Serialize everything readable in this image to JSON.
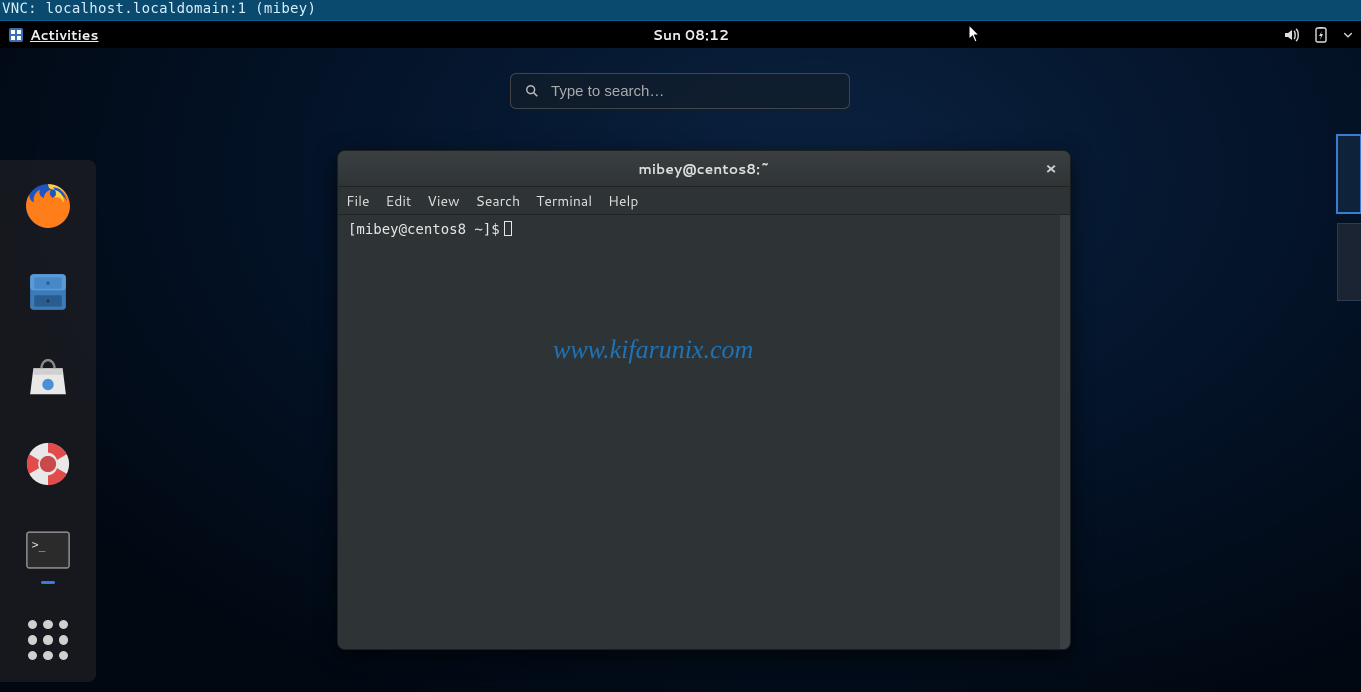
{
  "vnc_title": "VNC: localhost.localdomain:1 (mibey)",
  "panel": {
    "activities": "Activities",
    "clock": "Sun 08:12"
  },
  "search": {
    "placeholder": "Type to search…"
  },
  "dock": {
    "items": [
      {
        "name": "firefox"
      },
      {
        "name": "files"
      },
      {
        "name": "software"
      },
      {
        "name": "help"
      },
      {
        "name": "terminal",
        "active": true
      }
    ]
  },
  "workspaces": {
    "count": 2,
    "active": 0
  },
  "terminal": {
    "title": "mibey@centos8:~",
    "menu": [
      "File",
      "Edit",
      "View",
      "Search",
      "Terminal",
      "Help"
    ],
    "prompt": "[mibey@centos8 ~]$"
  },
  "watermark": "www.kifarunix.com"
}
